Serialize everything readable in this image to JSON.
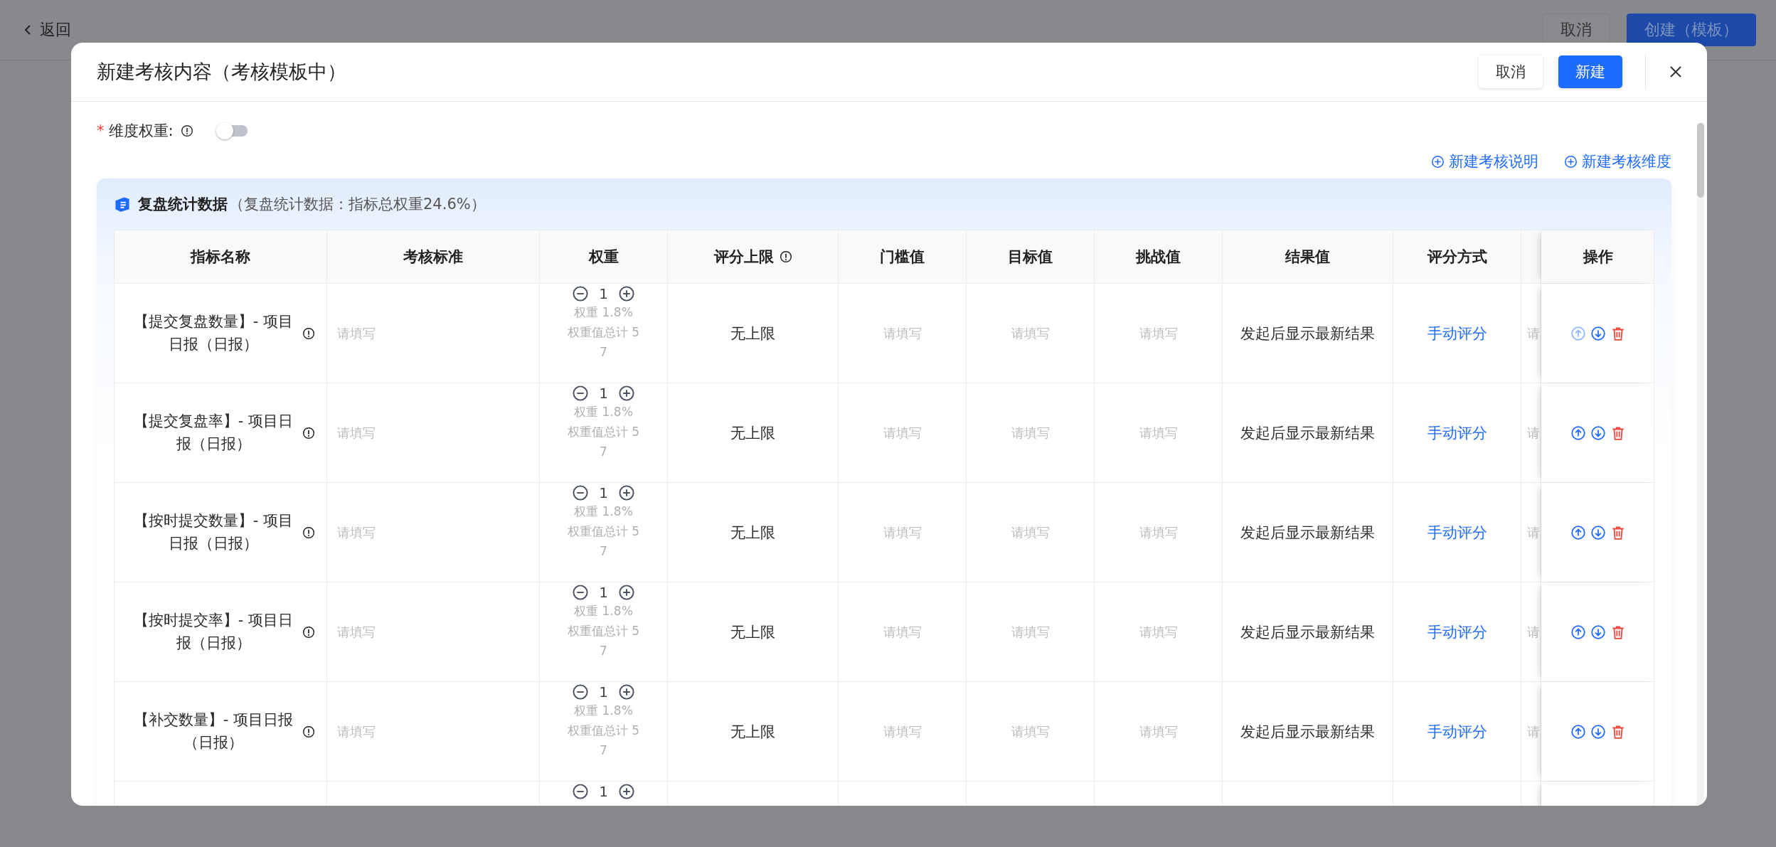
{
  "page": {
    "back": "返回",
    "cancel": "取消",
    "create": "创建（模板）"
  },
  "dialog": {
    "title": "新建考核内容（考核模板中）",
    "cancel": "取消",
    "confirm": "新建"
  },
  "weight_toggle": {
    "label": "维度权重:",
    "required_mark": "*",
    "on": false
  },
  "links": [
    "新建考核说明",
    "新建考核维度"
  ],
  "section": {
    "title": "复盘统计数据",
    "note": "（复盘统计数据：指标总权重24.6%）"
  },
  "table": {
    "columns": [
      {
        "label": "指标名称"
      },
      {
        "label": "考核标准"
      },
      {
        "label": "权重"
      },
      {
        "label": "评分上限",
        "info": true
      },
      {
        "label": "门槛值"
      },
      {
        "label": "目标值"
      },
      {
        "label": "挑战值"
      },
      {
        "label": "结果值"
      },
      {
        "label": "评分方式"
      }
    ],
    "action_column": "操作",
    "rows": [
      {
        "name": "【提交复盘数量】- 项目日报（日报）",
        "standard": {
          "placeholder": "请填写"
        },
        "weight": "1",
        "weight_pct": "权重 1.8%",
        "weight_total": "权重值总计 57",
        "upper": "无上限",
        "threshold": {
          "placeholder": "请填写"
        },
        "target": {
          "placeholder": "请填写"
        },
        "challenge": {
          "placeholder": "请填写"
        },
        "result": "发起后显示最新结果",
        "scoring": "手动评分",
        "column_10": "请",
        "up_disabled": true
      },
      {
        "name": "【提交复盘率】- 项目日报（日报）",
        "standard": {
          "placeholder": "请填写"
        },
        "weight": "1",
        "weight_pct": "权重 1.8%",
        "weight_total": "权重值总计 57",
        "upper": "无上限",
        "threshold": {
          "placeholder": "请填写"
        },
        "target": {
          "placeholder": "请填写"
        },
        "challenge": {
          "placeholder": "请填写"
        },
        "result": "发起后显示最新结果",
        "scoring": "手动评分",
        "column_10": "请",
        "up_disabled": false
      },
      {
        "name": "【按时提交数量】- 项目日报（日报）",
        "standard": {
          "placeholder": "请填写"
        },
        "weight": "1",
        "weight_pct": "权重 1.8%",
        "weight_total": "权重值总计 57",
        "upper": "无上限",
        "threshold": {
          "placeholder": "请填写"
        },
        "target": {
          "placeholder": "请填写"
        },
        "challenge": {
          "placeholder": "请填写"
        },
        "result": "发起后显示最新结果",
        "scoring": "手动评分",
        "column_10": "请",
        "up_disabled": false
      },
      {
        "name": "【按时提交率】- 项目日报（日报）",
        "standard": {
          "placeholder": "请填写"
        },
        "weight": "1",
        "weight_pct": "权重 1.8%",
        "weight_total": "权重值总计 57",
        "upper": "无上限",
        "threshold": {
          "placeholder": "请填写"
        },
        "target": {
          "placeholder": "请填写"
        },
        "challenge": {
          "placeholder": "请填写"
        },
        "result": "发起后显示最新结果",
        "scoring": "手动评分",
        "column_10": "请",
        "up_disabled": false
      },
      {
        "name": "【补交数量】- 项目日报（日报）",
        "standard": {
          "placeholder": "请填写"
        },
        "weight": "1",
        "weight_pct": "权重 1.8%",
        "weight_total": "权重值总计 57",
        "upper": "无上限",
        "threshold": {
          "placeholder": "请填写"
        },
        "target": {
          "placeholder": "请填写"
        },
        "challenge": {
          "placeholder": "请填写"
        },
        "result": "发起后显示最新结果",
        "scoring": "手动评分",
        "column_10": "请",
        "up_disabled": false
      },
      {
        "weight": "1"
      }
    ]
  }
}
